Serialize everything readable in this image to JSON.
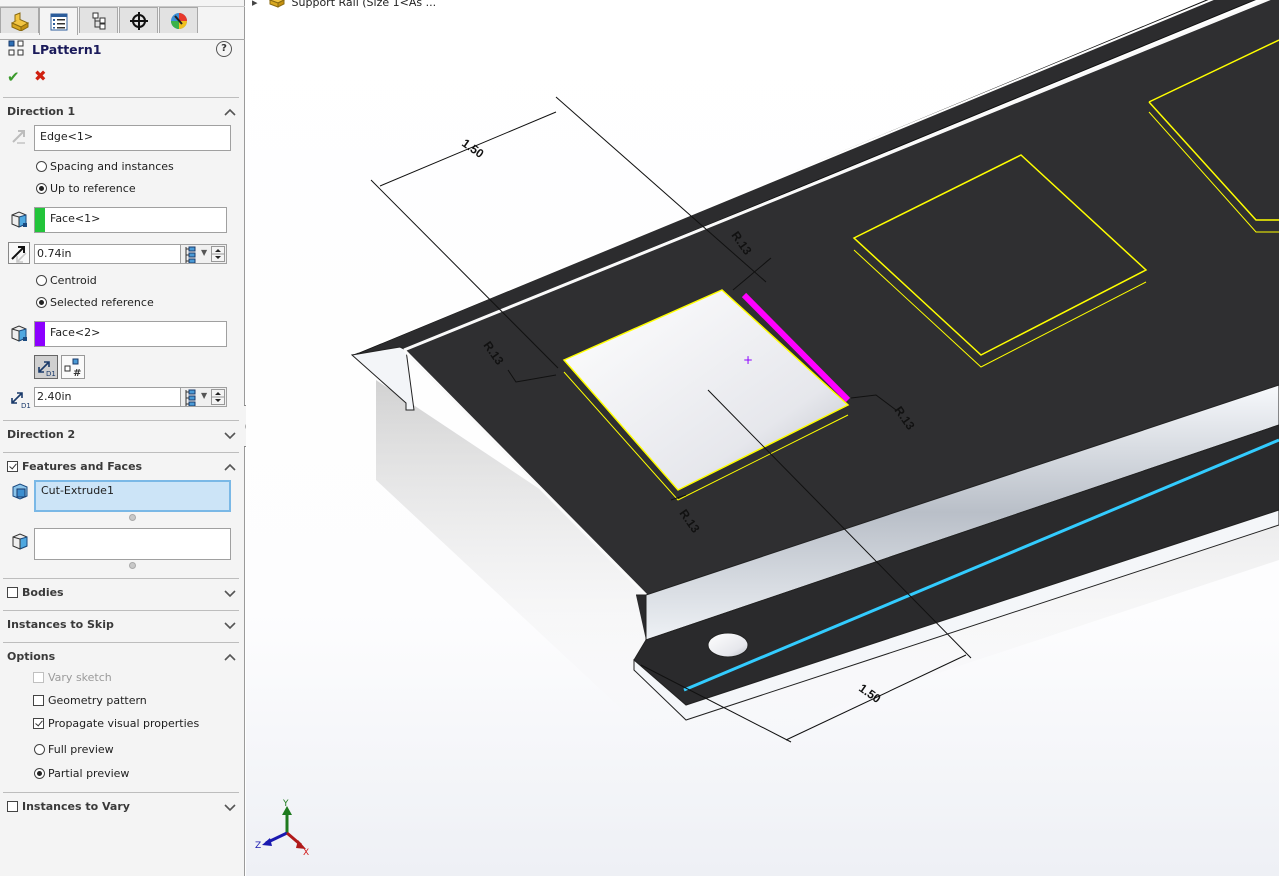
{
  "panel": {
    "tabs": [
      {
        "name": "featuremanager",
        "icon": "part-icon"
      },
      {
        "name": "propertymanager",
        "icon": "property-manager-icon",
        "active": true
      },
      {
        "name": "configurationmanager",
        "icon": "configuration-icon"
      },
      {
        "name": "dimxpertmanager",
        "icon": "crosshair-icon"
      },
      {
        "name": "displaymanager",
        "icon": "appearance-icon"
      }
    ],
    "title": "LPattern1",
    "help_label": "?",
    "ok_label": "✔",
    "cancel_label": "✖",
    "direction1": {
      "title": "Direction 1",
      "edge_field": "Edge<1>",
      "mode_options": [
        {
          "label": "Spacing and instances",
          "selected": false
        },
        {
          "label": "Up to reference",
          "selected": true
        }
      ],
      "reference_face": {
        "value": "Face<1>",
        "color": "#22c43a"
      },
      "offset_value": "0.74in",
      "origin_options": [
        {
          "label": "Centroid",
          "selected": false
        },
        {
          "label": "Selected reference",
          "selected": true
        }
      ],
      "seed_face": {
        "value": "Face<2>",
        "color": "#8c00ff"
      },
      "distance_value": "2.40in"
    },
    "direction2": {
      "title": "Direction 2"
    },
    "features_and_faces": {
      "title": "Features and Faces",
      "checked": true,
      "features_field": "Cut-Extrude1",
      "faces_field": ""
    },
    "bodies": {
      "title": "Bodies",
      "checked": false
    },
    "instances_to_skip": {
      "title": "Instances to Skip"
    },
    "options": {
      "title": "Options",
      "vary_sketch": {
        "label": "Vary sketch",
        "checked": false,
        "disabled": true
      },
      "geometry_pattern": {
        "label": "Geometry pattern",
        "checked": false
      },
      "propagate_visual": {
        "label": "Propagate visual properties",
        "checked": true
      },
      "full_preview": {
        "label": "Full preview",
        "selected": false
      },
      "partial_preview": {
        "label": "Partial preview",
        "selected": true
      }
    },
    "instances_to_vary": {
      "title": "Instances to Vary",
      "checked": false
    }
  },
  "viewport": {
    "tree_node": "Support Rail  (Size 1<As ...",
    "dimensions": {
      "top_distance": "1.50",
      "bottom_distance": "1.50",
      "radius_top_right": "R.13",
      "radius_left": "R.13",
      "radius_right": "R.13",
      "radius_bottom": "R.13"
    },
    "highlight_colors": {
      "selection_edge": "#ff00ff",
      "pattern_preview": "#ffff00",
      "edge_highlight": "#33ccff"
    },
    "triad": {
      "x": "X",
      "y": "Y",
      "z": "Z"
    }
  }
}
